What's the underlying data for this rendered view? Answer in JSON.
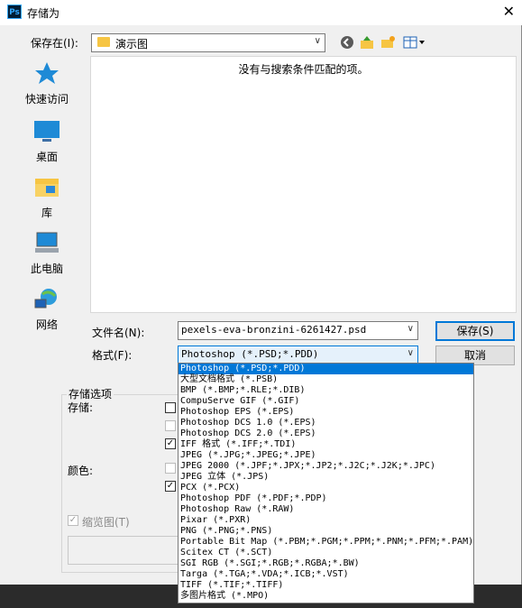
{
  "window": {
    "title": "存储为",
    "app_icon": "Ps"
  },
  "location": {
    "label": "保存在(I):",
    "value": "演示图"
  },
  "file_list": {
    "empty_text": "没有与搜索条件匹配的项。"
  },
  "places": [
    {
      "label": "快速访问",
      "icon": "quick-access-icon"
    },
    {
      "label": "桌面",
      "icon": "desktop-icon"
    },
    {
      "label": "库",
      "icon": "library-icon"
    },
    {
      "label": "此电脑",
      "icon": "this-pc-icon"
    },
    {
      "label": "网络",
      "icon": "network-icon"
    }
  ],
  "filename": {
    "label": "文件名(N):",
    "value": "pexels-eva-bronzini-6261427.psd"
  },
  "format": {
    "label": "格式(F):",
    "value": "Photoshop (*.PSD;*.PDD)"
  },
  "buttons": {
    "save": "保存(S)",
    "cancel": "取消"
  },
  "options": {
    "group_title": "存储选项",
    "save_label": "存储:",
    "color_label": "颜色:",
    "thumbnail_label": "缩览图(T)"
  },
  "format_options": [
    "Photoshop (*.PSD;*.PDD)",
    "大型文档格式 (*.PSB)",
    "BMP (*.BMP;*.RLE;*.DIB)",
    "CompuServe GIF (*.GIF)",
    "Photoshop EPS (*.EPS)",
    "Photoshop DCS 1.0 (*.EPS)",
    "Photoshop DCS 2.0 (*.EPS)",
    "IFF 格式 (*.IFF;*.TDI)",
    "JPEG (*.JPG;*.JPEG;*.JPE)",
    "JPEG 2000 (*.JPF;*.JPX;*.JP2;*.J2C;*.J2K;*.JPC)",
    "JPEG 立体 (*.JPS)",
    "PCX (*.PCX)",
    "Photoshop PDF (*.PDF;*.PDP)",
    "Photoshop Raw (*.RAW)",
    "Pixar (*.PXR)",
    "PNG (*.PNG;*.PNS)",
    "Portable Bit Map (*.PBM;*.PGM;*.PPM;*.PNM;*.PFM;*.PAM)",
    "Scitex CT (*.SCT)",
    "SGI RGB (*.SGI;*.RGB;*.RGBA;*.BW)",
    "Targa (*.TGA;*.VDA;*.ICB;*.VST)",
    "TIFF (*.TIF;*.TIFF)",
    "多图片格式 (*.MPO)"
  ],
  "colors": {
    "accent": "#0078d7"
  }
}
